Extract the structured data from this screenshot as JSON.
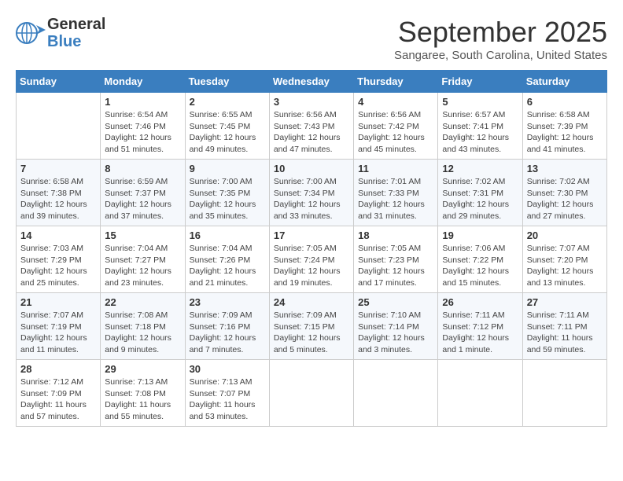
{
  "header": {
    "logo_line1": "General",
    "logo_line2": "Blue",
    "month": "September 2025",
    "location": "Sangaree, South Carolina, United States"
  },
  "days_of_week": [
    "Sunday",
    "Monday",
    "Tuesday",
    "Wednesday",
    "Thursday",
    "Friday",
    "Saturday"
  ],
  "weeks": [
    [
      {
        "day": "",
        "info": ""
      },
      {
        "day": "1",
        "info": "Sunrise: 6:54 AM\nSunset: 7:46 PM\nDaylight: 12 hours\nand 51 minutes."
      },
      {
        "day": "2",
        "info": "Sunrise: 6:55 AM\nSunset: 7:45 PM\nDaylight: 12 hours\nand 49 minutes."
      },
      {
        "day": "3",
        "info": "Sunrise: 6:56 AM\nSunset: 7:43 PM\nDaylight: 12 hours\nand 47 minutes."
      },
      {
        "day": "4",
        "info": "Sunrise: 6:56 AM\nSunset: 7:42 PM\nDaylight: 12 hours\nand 45 minutes."
      },
      {
        "day": "5",
        "info": "Sunrise: 6:57 AM\nSunset: 7:41 PM\nDaylight: 12 hours\nand 43 minutes."
      },
      {
        "day": "6",
        "info": "Sunrise: 6:58 AM\nSunset: 7:39 PM\nDaylight: 12 hours\nand 41 minutes."
      }
    ],
    [
      {
        "day": "7",
        "info": "Sunrise: 6:58 AM\nSunset: 7:38 PM\nDaylight: 12 hours\nand 39 minutes."
      },
      {
        "day": "8",
        "info": "Sunrise: 6:59 AM\nSunset: 7:37 PM\nDaylight: 12 hours\nand 37 minutes."
      },
      {
        "day": "9",
        "info": "Sunrise: 7:00 AM\nSunset: 7:35 PM\nDaylight: 12 hours\nand 35 minutes."
      },
      {
        "day": "10",
        "info": "Sunrise: 7:00 AM\nSunset: 7:34 PM\nDaylight: 12 hours\nand 33 minutes."
      },
      {
        "day": "11",
        "info": "Sunrise: 7:01 AM\nSunset: 7:33 PM\nDaylight: 12 hours\nand 31 minutes."
      },
      {
        "day": "12",
        "info": "Sunrise: 7:02 AM\nSunset: 7:31 PM\nDaylight: 12 hours\nand 29 minutes."
      },
      {
        "day": "13",
        "info": "Sunrise: 7:02 AM\nSunset: 7:30 PM\nDaylight: 12 hours\nand 27 minutes."
      }
    ],
    [
      {
        "day": "14",
        "info": "Sunrise: 7:03 AM\nSunset: 7:29 PM\nDaylight: 12 hours\nand 25 minutes."
      },
      {
        "day": "15",
        "info": "Sunrise: 7:04 AM\nSunset: 7:27 PM\nDaylight: 12 hours\nand 23 minutes."
      },
      {
        "day": "16",
        "info": "Sunrise: 7:04 AM\nSunset: 7:26 PM\nDaylight: 12 hours\nand 21 minutes."
      },
      {
        "day": "17",
        "info": "Sunrise: 7:05 AM\nSunset: 7:24 PM\nDaylight: 12 hours\nand 19 minutes."
      },
      {
        "day": "18",
        "info": "Sunrise: 7:05 AM\nSunset: 7:23 PM\nDaylight: 12 hours\nand 17 minutes."
      },
      {
        "day": "19",
        "info": "Sunrise: 7:06 AM\nSunset: 7:22 PM\nDaylight: 12 hours\nand 15 minutes."
      },
      {
        "day": "20",
        "info": "Sunrise: 7:07 AM\nSunset: 7:20 PM\nDaylight: 12 hours\nand 13 minutes."
      }
    ],
    [
      {
        "day": "21",
        "info": "Sunrise: 7:07 AM\nSunset: 7:19 PM\nDaylight: 12 hours\nand 11 minutes."
      },
      {
        "day": "22",
        "info": "Sunrise: 7:08 AM\nSunset: 7:18 PM\nDaylight: 12 hours\nand 9 minutes."
      },
      {
        "day": "23",
        "info": "Sunrise: 7:09 AM\nSunset: 7:16 PM\nDaylight: 12 hours\nand 7 minutes."
      },
      {
        "day": "24",
        "info": "Sunrise: 7:09 AM\nSunset: 7:15 PM\nDaylight: 12 hours\nand 5 minutes."
      },
      {
        "day": "25",
        "info": "Sunrise: 7:10 AM\nSunset: 7:14 PM\nDaylight: 12 hours\nand 3 minutes."
      },
      {
        "day": "26",
        "info": "Sunrise: 7:11 AM\nSunset: 7:12 PM\nDaylight: 12 hours\nand 1 minute."
      },
      {
        "day": "27",
        "info": "Sunrise: 7:11 AM\nSunset: 7:11 PM\nDaylight: 11 hours\nand 59 minutes."
      }
    ],
    [
      {
        "day": "28",
        "info": "Sunrise: 7:12 AM\nSunset: 7:09 PM\nDaylight: 11 hours\nand 57 minutes."
      },
      {
        "day": "29",
        "info": "Sunrise: 7:13 AM\nSunset: 7:08 PM\nDaylight: 11 hours\nand 55 minutes."
      },
      {
        "day": "30",
        "info": "Sunrise: 7:13 AM\nSunset: 7:07 PM\nDaylight: 11 hours\nand 53 minutes."
      },
      {
        "day": "",
        "info": ""
      },
      {
        "day": "",
        "info": ""
      },
      {
        "day": "",
        "info": ""
      },
      {
        "day": "",
        "info": ""
      }
    ]
  ]
}
